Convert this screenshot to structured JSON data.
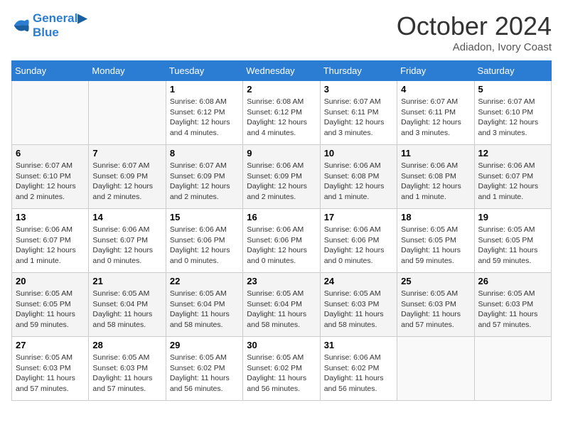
{
  "header": {
    "logo_line1": "General",
    "logo_line2": "Blue",
    "month": "October 2024",
    "location": "Adiadon, Ivory Coast"
  },
  "weekdays": [
    "Sunday",
    "Monday",
    "Tuesday",
    "Wednesday",
    "Thursday",
    "Friday",
    "Saturday"
  ],
  "weeks": [
    [
      {
        "num": "",
        "detail": ""
      },
      {
        "num": "",
        "detail": ""
      },
      {
        "num": "1",
        "detail": "Sunrise: 6:08 AM\nSunset: 6:12 PM\nDaylight: 12 hours and 4 minutes."
      },
      {
        "num": "2",
        "detail": "Sunrise: 6:08 AM\nSunset: 6:12 PM\nDaylight: 12 hours and 4 minutes."
      },
      {
        "num": "3",
        "detail": "Sunrise: 6:07 AM\nSunset: 6:11 PM\nDaylight: 12 hours and 3 minutes."
      },
      {
        "num": "4",
        "detail": "Sunrise: 6:07 AM\nSunset: 6:11 PM\nDaylight: 12 hours and 3 minutes."
      },
      {
        "num": "5",
        "detail": "Sunrise: 6:07 AM\nSunset: 6:10 PM\nDaylight: 12 hours and 3 minutes."
      }
    ],
    [
      {
        "num": "6",
        "detail": "Sunrise: 6:07 AM\nSunset: 6:10 PM\nDaylight: 12 hours and 2 minutes."
      },
      {
        "num": "7",
        "detail": "Sunrise: 6:07 AM\nSunset: 6:09 PM\nDaylight: 12 hours and 2 minutes."
      },
      {
        "num": "8",
        "detail": "Sunrise: 6:07 AM\nSunset: 6:09 PM\nDaylight: 12 hours and 2 minutes."
      },
      {
        "num": "9",
        "detail": "Sunrise: 6:06 AM\nSunset: 6:09 PM\nDaylight: 12 hours and 2 minutes."
      },
      {
        "num": "10",
        "detail": "Sunrise: 6:06 AM\nSunset: 6:08 PM\nDaylight: 12 hours and 1 minute."
      },
      {
        "num": "11",
        "detail": "Sunrise: 6:06 AM\nSunset: 6:08 PM\nDaylight: 12 hours and 1 minute."
      },
      {
        "num": "12",
        "detail": "Sunrise: 6:06 AM\nSunset: 6:07 PM\nDaylight: 12 hours and 1 minute."
      }
    ],
    [
      {
        "num": "13",
        "detail": "Sunrise: 6:06 AM\nSunset: 6:07 PM\nDaylight: 12 hours and 1 minute."
      },
      {
        "num": "14",
        "detail": "Sunrise: 6:06 AM\nSunset: 6:07 PM\nDaylight: 12 hours and 0 minutes."
      },
      {
        "num": "15",
        "detail": "Sunrise: 6:06 AM\nSunset: 6:06 PM\nDaylight: 12 hours and 0 minutes."
      },
      {
        "num": "16",
        "detail": "Sunrise: 6:06 AM\nSunset: 6:06 PM\nDaylight: 12 hours and 0 minutes."
      },
      {
        "num": "17",
        "detail": "Sunrise: 6:06 AM\nSunset: 6:06 PM\nDaylight: 12 hours and 0 minutes."
      },
      {
        "num": "18",
        "detail": "Sunrise: 6:05 AM\nSunset: 6:05 PM\nDaylight: 11 hours and 59 minutes."
      },
      {
        "num": "19",
        "detail": "Sunrise: 6:05 AM\nSunset: 6:05 PM\nDaylight: 11 hours and 59 minutes."
      }
    ],
    [
      {
        "num": "20",
        "detail": "Sunrise: 6:05 AM\nSunset: 6:05 PM\nDaylight: 11 hours and 59 minutes."
      },
      {
        "num": "21",
        "detail": "Sunrise: 6:05 AM\nSunset: 6:04 PM\nDaylight: 11 hours and 58 minutes."
      },
      {
        "num": "22",
        "detail": "Sunrise: 6:05 AM\nSunset: 6:04 PM\nDaylight: 11 hours and 58 minutes."
      },
      {
        "num": "23",
        "detail": "Sunrise: 6:05 AM\nSunset: 6:04 PM\nDaylight: 11 hours and 58 minutes."
      },
      {
        "num": "24",
        "detail": "Sunrise: 6:05 AM\nSunset: 6:03 PM\nDaylight: 11 hours and 58 minutes."
      },
      {
        "num": "25",
        "detail": "Sunrise: 6:05 AM\nSunset: 6:03 PM\nDaylight: 11 hours and 57 minutes."
      },
      {
        "num": "26",
        "detail": "Sunrise: 6:05 AM\nSunset: 6:03 PM\nDaylight: 11 hours and 57 minutes."
      }
    ],
    [
      {
        "num": "27",
        "detail": "Sunrise: 6:05 AM\nSunset: 6:03 PM\nDaylight: 11 hours and 57 minutes."
      },
      {
        "num": "28",
        "detail": "Sunrise: 6:05 AM\nSunset: 6:03 PM\nDaylight: 11 hours and 57 minutes."
      },
      {
        "num": "29",
        "detail": "Sunrise: 6:05 AM\nSunset: 6:02 PM\nDaylight: 11 hours and 56 minutes."
      },
      {
        "num": "30",
        "detail": "Sunrise: 6:05 AM\nSunset: 6:02 PM\nDaylight: 11 hours and 56 minutes."
      },
      {
        "num": "31",
        "detail": "Sunrise: 6:06 AM\nSunset: 6:02 PM\nDaylight: 11 hours and 56 minutes."
      },
      {
        "num": "",
        "detail": ""
      },
      {
        "num": "",
        "detail": ""
      }
    ]
  ]
}
